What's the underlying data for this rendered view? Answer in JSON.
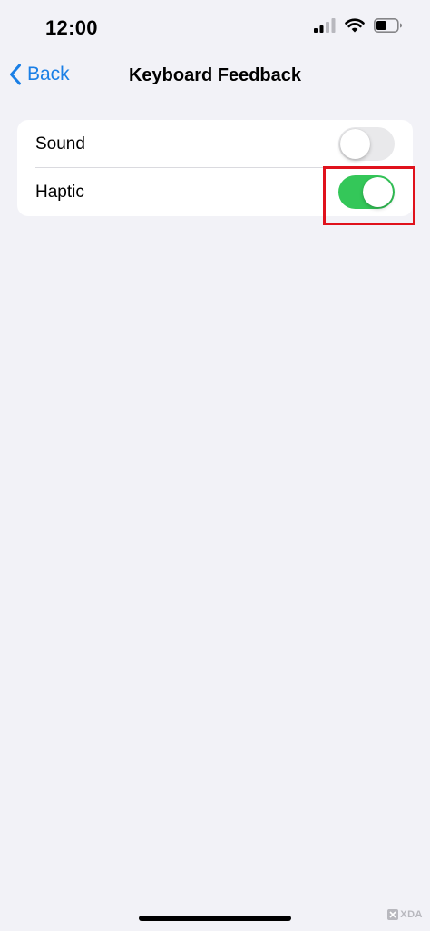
{
  "status_bar": {
    "time": "12:00",
    "signal_icon": "cellular-signal-icon",
    "wifi_icon": "wifi-icon",
    "battery_icon": "battery-icon",
    "battery_level": 0.5
  },
  "nav": {
    "back_label": "Back",
    "back_icon": "chevron-left-icon",
    "title": "Keyboard Feedback"
  },
  "settings": {
    "rows": [
      {
        "label": "Sound",
        "enabled": false
      },
      {
        "label": "Haptic",
        "enabled": true
      }
    ]
  },
  "colors": {
    "accent": "#1A7FE6",
    "toggle_on": "#34C759",
    "toggle_off": "#E9E9EB",
    "highlight": "#E0121C",
    "background": "#F2F2F7"
  },
  "watermark": {
    "text": "XDA"
  }
}
